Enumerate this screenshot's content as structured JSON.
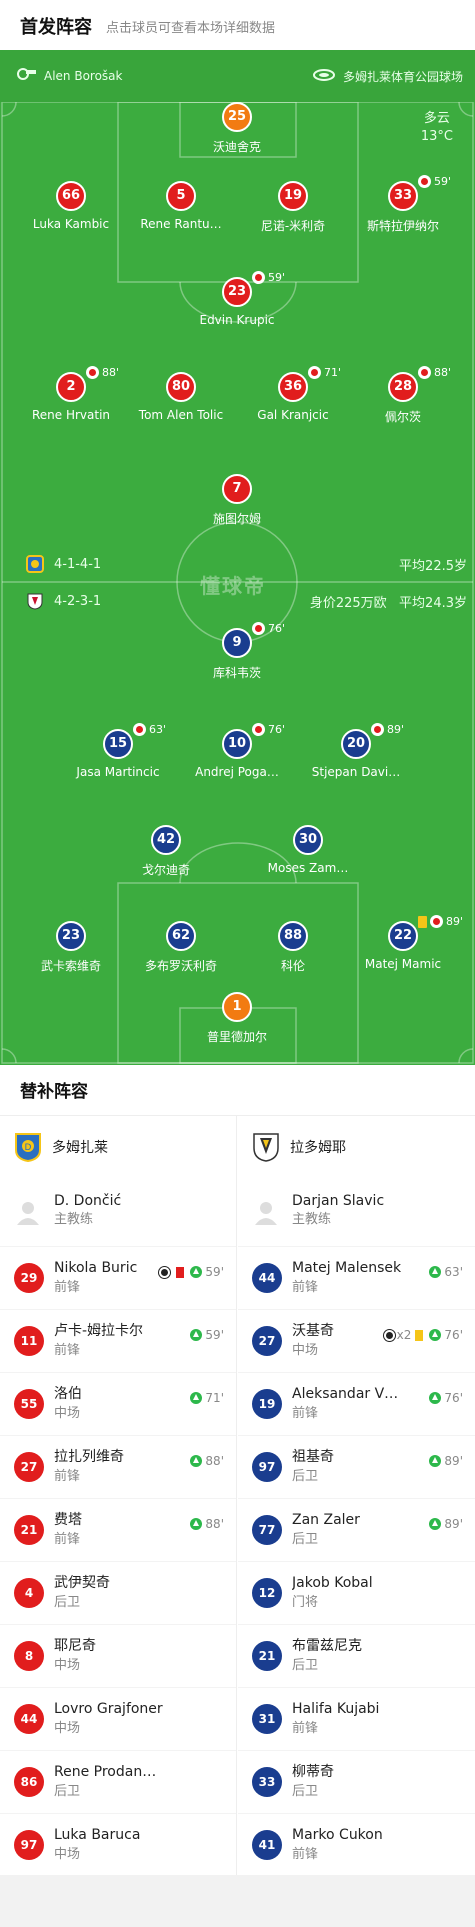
{
  "header": {
    "title": "首发阵容",
    "subtitle": "点击球员可查看本场详细数据"
  },
  "pitch": {
    "referee": "Alen Borošak",
    "venue": "多姆扎莱体育公园球场",
    "weather": "多云",
    "temperature": "13°C",
    "watermark": "懂球帝",
    "home_formation": "4-1-4-1",
    "home_avg_age": "平均22.5岁",
    "away_formation": "4-2-3-1",
    "away_value": "身价225万欧",
    "away_avg_age": "平均24.3岁"
  },
  "home_players": [
    {
      "num": "25",
      "name": "沃迪舍克",
      "color": "orange"
    },
    {
      "num": "66",
      "name": "Luka Kambic",
      "color": "red"
    },
    {
      "num": "5",
      "name": "Rene Rantu…",
      "color": "red"
    },
    {
      "num": "19",
      "name": "尼诺-米利奇",
      "color": "red"
    },
    {
      "num": "33",
      "name": "斯特拉伊纳尔",
      "color": "red",
      "sub": "59'"
    },
    {
      "num": "23",
      "name": "Edvin Krupic",
      "color": "red",
      "sub": "59'"
    },
    {
      "num": "2",
      "name": "Rene Hrvatin",
      "color": "red",
      "sub": "88'"
    },
    {
      "num": "80",
      "name": "Tom Alen Tolic",
      "color": "red"
    },
    {
      "num": "36",
      "name": "Gal Kranjcic",
      "color": "red",
      "sub": "71'"
    },
    {
      "num": "28",
      "name": "佩尔茨",
      "color": "red",
      "sub": "88'"
    },
    {
      "num": "7",
      "name": "施图尔姆",
      "color": "red"
    }
  ],
  "away_players": [
    {
      "num": "9",
      "name": "库科韦茨",
      "color": "blue",
      "sub": "76'"
    },
    {
      "num": "15",
      "name": "Jasa Martincic",
      "color": "blue",
      "sub": "63'"
    },
    {
      "num": "10",
      "name": "Andrej Poga…",
      "color": "blue",
      "sub": "76'"
    },
    {
      "num": "20",
      "name": "Stjepan Davi…",
      "color": "blue",
      "sub": "89'"
    },
    {
      "num": "42",
      "name": "戈尔迪奇",
      "color": "blue"
    },
    {
      "num": "30",
      "name": "Moses Zam…",
      "color": "blue"
    },
    {
      "num": "23",
      "name": "武卡索维奇",
      "color": "blue"
    },
    {
      "num": "62",
      "name": "多布罗沃利奇",
      "color": "blue"
    },
    {
      "num": "88",
      "name": "科伦",
      "color": "blue"
    },
    {
      "num": "22",
      "name": "Matej Mamic",
      "color": "blue",
      "sub": "89'",
      "yellow": true
    },
    {
      "num": "1",
      "name": "普里德加尔",
      "color": "orange"
    }
  ],
  "subs": {
    "title": "替补阵容",
    "home": {
      "team": "多姆扎莱",
      "coach": {
        "name": "D. Dončić",
        "role": "主教练"
      },
      "players": [
        {
          "num": "29",
          "name": "Nikola Buric",
          "pos": "前锋",
          "min": "59'"
        },
        {
          "num": "11",
          "name": "卢卡-姆拉卡尔",
          "pos": "前锋",
          "min": "59'"
        },
        {
          "num": "55",
          "name": "洛伯",
          "pos": "中场",
          "min": "71'"
        },
        {
          "num": "27",
          "name": "拉扎列维奇",
          "pos": "前锋",
          "min": "88'"
        },
        {
          "num": "21",
          "name": "费塔",
          "pos": "前锋",
          "min": "88'"
        },
        {
          "num": "4",
          "name": "武伊契奇",
          "pos": "后卫",
          "min": ""
        },
        {
          "num": "8",
          "name": "耶尼奇",
          "pos": "中场",
          "min": ""
        },
        {
          "num": "44",
          "name": "Lovro Grajfoner",
          "pos": "中场",
          "min": ""
        },
        {
          "num": "86",
          "name": "Rene Prodan…",
          "pos": "后卫",
          "min": ""
        },
        {
          "num": "97",
          "name": "Luka Baruca",
          "pos": "中场",
          "min": ""
        }
      ]
    },
    "away": {
      "team": "拉多姆耶",
      "coach": {
        "name": "Darjan Slavic",
        "role": "主教练"
      },
      "players": [
        {
          "num": "44",
          "name": "Matej Malensek",
          "pos": "前锋",
          "min": "63'"
        },
        {
          "num": "27",
          "name": "沃基奇",
          "pos": "中场",
          "min": "76'",
          "goals": "x2"
        },
        {
          "num": "19",
          "name": "Aleksandar V…",
          "pos": "前锋",
          "min": "76'"
        },
        {
          "num": "97",
          "name": "祖基奇",
          "pos": "后卫",
          "min": "89'"
        },
        {
          "num": "77",
          "name": "Zan Zaler",
          "pos": "后卫",
          "min": "89'"
        },
        {
          "num": "12",
          "name": "Jakob Kobal",
          "pos": "门将",
          "min": ""
        },
        {
          "num": "21",
          "name": "布雷兹尼克",
          "pos": "后卫",
          "min": ""
        },
        {
          "num": "31",
          "name": "Halifa Kujabi",
          "pos": "前锋",
          "min": ""
        },
        {
          "num": "33",
          "name": "柳蒂奇",
          "pos": "后卫",
          "min": ""
        },
        {
          "num": "41",
          "name": "Marko Cukon",
          "pos": "前锋",
          "min": ""
        }
      ]
    }
  },
  "colors": {
    "pitch": "#3cac3f",
    "home": "#e11d1d",
    "away": "#1a3d8f",
    "keeper": "#f27b12"
  }
}
